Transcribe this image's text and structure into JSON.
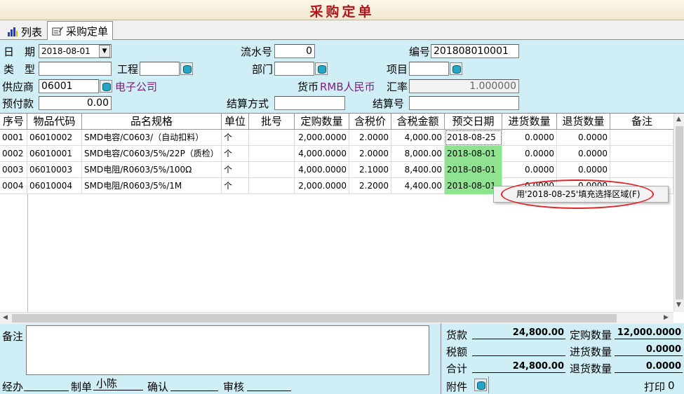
{
  "window": {
    "title": "采购定单"
  },
  "tabs": [
    {
      "label": "列表"
    },
    {
      "label": "采购定单"
    }
  ],
  "form": {
    "date_label": "日　期",
    "date_value": "2018-08-01",
    "serial_label": "流水号",
    "serial_value": "0",
    "number_label": "编号",
    "number_value": "201808010001",
    "type_label": "类　型",
    "type_value": "",
    "project_eng_label": "工程",
    "project_eng_value": "",
    "department_label": "部门",
    "department_value": "",
    "item_label": "项目",
    "item_value": "",
    "supplier_label": "供应商",
    "supplier_code": "06001",
    "supplier_name": "电子公司",
    "currency_label": "货币",
    "currency_value": "RMB人民币",
    "rate_label": "汇率",
    "rate_value": "1.000000",
    "prepay_label": "预付款",
    "prepay_value": "0.00",
    "settle_method_label": "结算方式",
    "settle_method_value": "",
    "settle_no_label": "结算号",
    "settle_no_value": ""
  },
  "table": {
    "headers": [
      "序号",
      "物品代码",
      "品名规格",
      "单位",
      "批号",
      "定购数量",
      "含税价",
      "含税金额",
      "预交日期",
      "进货数量",
      "退货数量",
      "备注"
    ],
    "rows": [
      {
        "seq": "0001",
        "code": "06010002",
        "name": "SMD电容/C0603/（自动扣料）",
        "unit": "个",
        "batch": "",
        "qty": "2,000.0000",
        "price": "2.0000",
        "amount": "4,000.00",
        "due": "2018-08-25",
        "in_qty": "0.0000",
        "ret_qty": "0.0000",
        "note": ""
      },
      {
        "seq": "0002",
        "code": "06010001",
        "name": "SMD电容/C0603/5%/22P（质检）",
        "unit": "个",
        "batch": "",
        "qty": "4,000.0000",
        "price": "2.0000",
        "amount": "8,000.00",
        "due": "2018-08-01",
        "in_qty": "0.0000",
        "ret_qty": "0.0000",
        "note": ""
      },
      {
        "seq": "0003",
        "code": "06010003",
        "name": "SMD电阻/R0603/5%/100Ω",
        "unit": "个",
        "batch": "",
        "qty": "4,000.0000",
        "price": "2.1000",
        "amount": "8,400.00",
        "due": "2018-08-01",
        "in_qty": "0.0000",
        "ret_qty": "0.0000",
        "note": ""
      },
      {
        "seq": "0004",
        "code": "06010004",
        "name": "SMD电阻/R0603/5%/1M",
        "unit": "个",
        "batch": "",
        "qty": "2,000.0000",
        "price": "2.2000",
        "amount": "4,400.00",
        "due": "2018-08-01",
        "in_qty": "0.0000",
        "ret_qty": "0.0000",
        "note": ""
      }
    ],
    "highlight_color": "#8fe28f"
  },
  "context_menu": {
    "item": "用'2018-08-25'填充选择区域(F)"
  },
  "footer": {
    "note_label": "备注",
    "payment_label": "货款",
    "payment_value": "24,800.00",
    "tax_label": "税额",
    "tax_value": "",
    "total_label": "合计",
    "total_value": "24,800.00",
    "order_qty_label": "定购数量",
    "order_qty_value": "12,000.0000",
    "in_qty_label": "进货数量",
    "in_qty_value": "0.0000",
    "ret_qty_label": "退货数量",
    "ret_qty_value": "0.0000",
    "handler_label": "经办",
    "handler_value": "",
    "maker_label": "制单",
    "maker_value": "小陈",
    "confirm_label": "确认",
    "confirm_value": "",
    "audit_label": "审核",
    "audit_value": "",
    "attachment_label": "附件",
    "print_label": "打印",
    "print_value": "0"
  },
  "colors": {
    "title": "#b0161d",
    "background": "#cfeef5",
    "link_purple": "#7b1f7b",
    "annotation": "#e0242a"
  }
}
